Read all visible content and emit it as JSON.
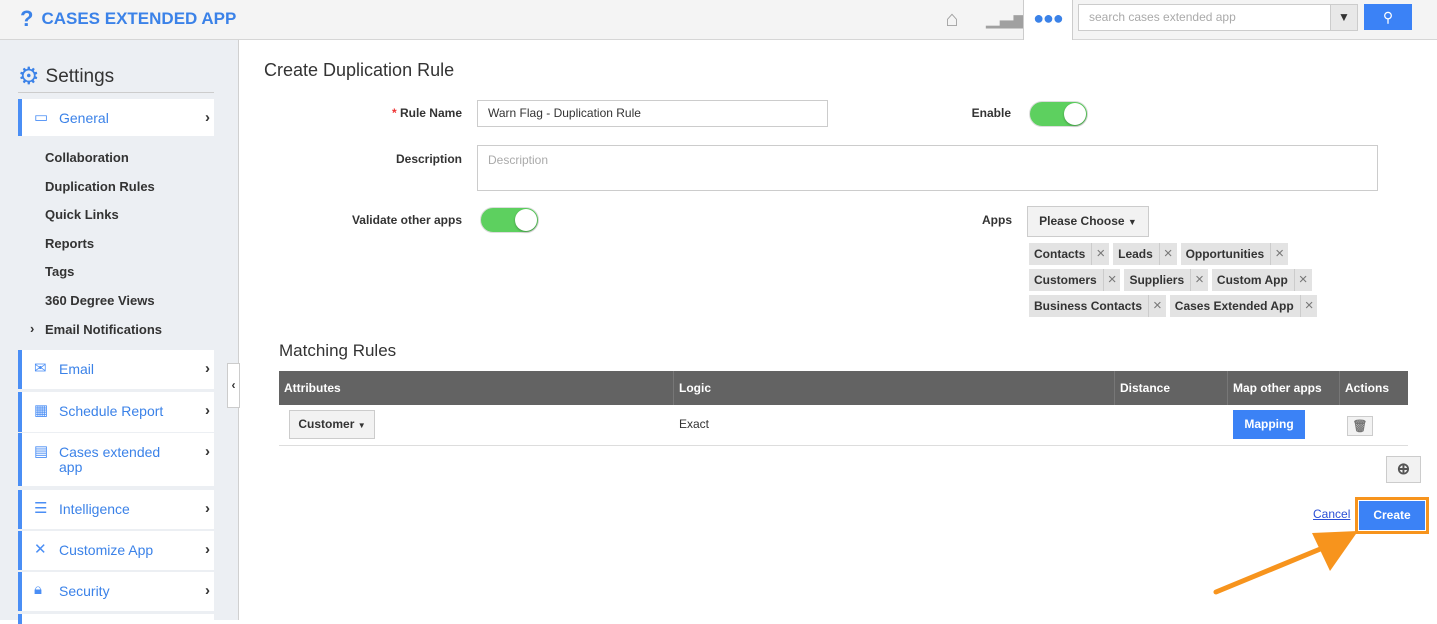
{
  "header": {
    "app_title": "CASES EXTENDED APP",
    "search_placeholder": "search cases extended app",
    "icons": [
      "home-icon",
      "chart-icon",
      "more-icon",
      "search-icon"
    ]
  },
  "sidebar": {
    "title": "Settings",
    "items": [
      {
        "label": "General",
        "icon": "monitor-icon"
      },
      {
        "label": "Email",
        "icon": "envelope-icon"
      },
      {
        "label": "Schedule Report",
        "icon": "calendar-chart-icon"
      },
      {
        "label": "Cases extended app",
        "icon": "window-icon"
      },
      {
        "label": "Intelligence",
        "icon": "lines-icon"
      },
      {
        "label": "Customize App",
        "icon": "tools-icon"
      },
      {
        "label": "Security",
        "icon": "lock-icon"
      }
    ],
    "general_sub": [
      "Collaboration",
      "Duplication Rules",
      "Quick Links",
      "Reports",
      "Tags",
      "360 Degree Views",
      "Email Notifications"
    ]
  },
  "form": {
    "title": "Create Duplication Rule",
    "rule_name_label": "Rule Name",
    "rule_name_value": "Warn Flag - Duplication Rule",
    "enable_label": "Enable",
    "enable_on": true,
    "description_label": "Description",
    "description_placeholder": "Description",
    "validate_label": "Validate other apps",
    "validate_on": true,
    "apps_label": "Apps",
    "apps_dropdown": "Please Choose",
    "apps_tags": [
      "Contacts",
      "Leads",
      "Opportunities",
      "Customers",
      "Suppliers",
      "Custom App",
      "Business Contacts",
      "Cases Extended App"
    ]
  },
  "matching": {
    "title": "Matching Rules",
    "columns": [
      "Attributes",
      "Logic",
      "Distance",
      "Map other apps",
      "Actions"
    ],
    "rows": [
      {
        "attribute": "Customer",
        "logic": "Exact",
        "distance": "",
        "map_label": "Mapping"
      }
    ]
  },
  "actions": {
    "cancel": "Cancel",
    "create": "Create"
  },
  "colors": {
    "accent": "#3b82f6",
    "toggle_on": "#5dd05f",
    "highlight": "#f7941d",
    "table_header": "#636363"
  }
}
